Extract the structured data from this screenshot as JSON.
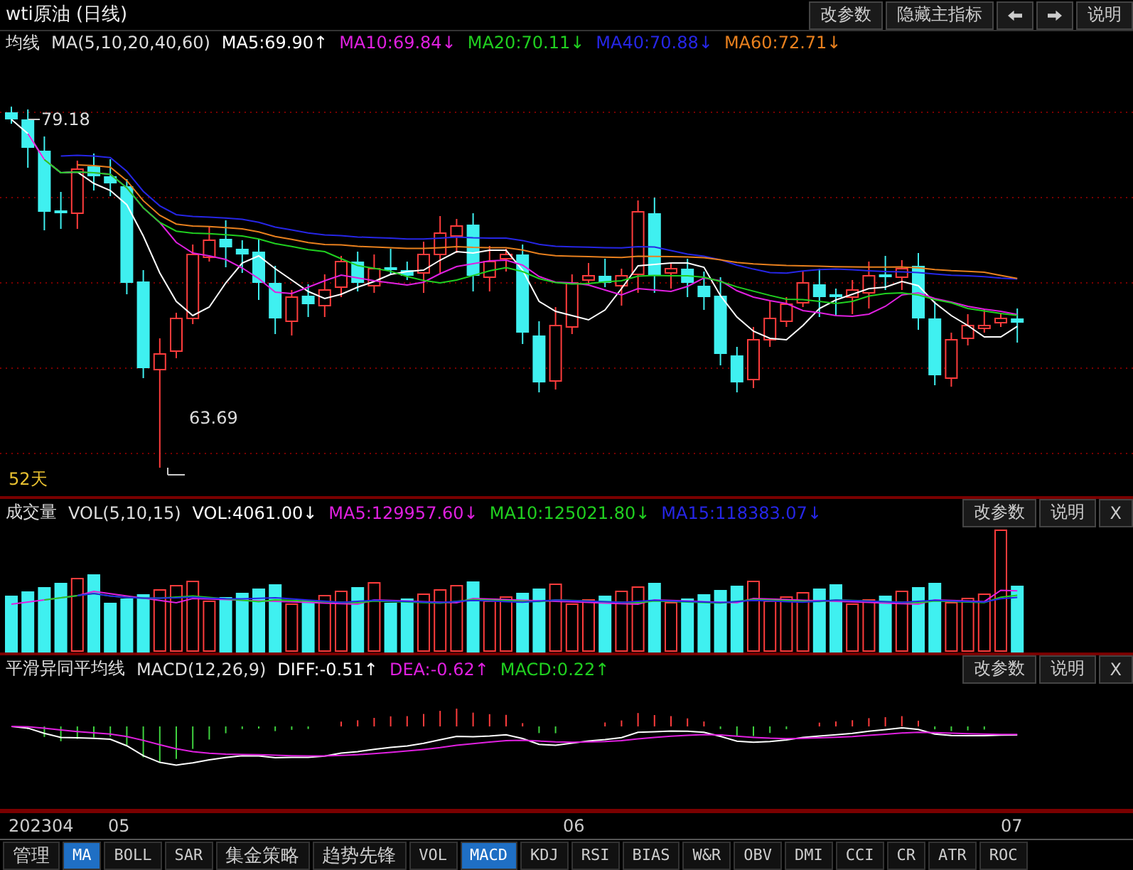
{
  "window": {
    "title": "wti原油 (日线)"
  },
  "toolbar": {
    "buttons": [
      {
        "kind": "text",
        "label": "改参数"
      },
      {
        "kind": "text",
        "label": "隐藏主指标"
      },
      {
        "kind": "prev"
      },
      {
        "kind": "next"
      },
      {
        "kind": "text",
        "label": "说明"
      }
    ]
  },
  "main_panel": {
    "title": "均线",
    "params": "MA(5,10,20,40,60)",
    "legend": [
      {
        "text": "MA5:69.90↑",
        "color": "#ffffff"
      },
      {
        "text": "MA10:69.84↓",
        "color": "#e020e0"
      },
      {
        "text": "MA20:70.11↓",
        "color": "#20d020"
      },
      {
        "text": "MA40:70.88↓",
        "color": "#2626e6"
      },
      {
        "text": "MA60:72.71↓",
        "color": "#e8801e"
      }
    ],
    "high_label": "79.18",
    "low_label": "63.69",
    "period": "52天"
  },
  "volume_panel": {
    "title": "成交量",
    "params": "VOL(5,10,15)",
    "legend": [
      {
        "text": "VOL:4061.00↓",
        "color": "#ffffff"
      },
      {
        "text": "MA5:129957.60↓",
        "color": "#e020e0"
      },
      {
        "text": "MA10:125021.80↓",
        "color": "#20d020"
      },
      {
        "text": "MA15:118383.07↓",
        "color": "#2626e6"
      }
    ],
    "buttons": [
      "改参数",
      "说明",
      "X"
    ]
  },
  "macd_panel": {
    "title": "平滑异同平均线",
    "params": "MACD(12,26,9)",
    "legend": [
      {
        "text": "DIFF:-0.51↑",
        "color": "#ffffff"
      },
      {
        "text": "DEA:-0.62↑",
        "color": "#e020e0"
      },
      {
        "text": "MACD:0.22↑",
        "color": "#20d020"
      }
    ],
    "buttons": [
      "改参数",
      "说明",
      "X"
    ]
  },
  "date_axis": [
    "202304",
    "05",
    "06",
    "07"
  ],
  "tabs": [
    {
      "label": "管理",
      "selected": false
    },
    {
      "label": "MA",
      "selected": true
    },
    {
      "label": "BOLL",
      "selected": false
    },
    {
      "label": "SAR",
      "selected": false
    },
    {
      "label": "集金策略",
      "selected": false
    },
    {
      "label": "趋势先锋",
      "selected": false
    },
    {
      "label": "VOL",
      "selected": false
    },
    {
      "label": "MACD",
      "selected": true
    },
    {
      "label": "KDJ",
      "selected": false
    },
    {
      "label": "RSI",
      "selected": false
    },
    {
      "label": "BIAS",
      "selected": false
    },
    {
      "label": "W&R",
      "selected": false
    },
    {
      "label": "OBV",
      "selected": false
    },
    {
      "label": "DMI",
      "selected": false
    },
    {
      "label": "CCI",
      "selected": false
    },
    {
      "label": "CR",
      "selected": false
    },
    {
      "label": "ATR",
      "selected": false
    },
    {
      "label": "ROC",
      "selected": false
    }
  ]
}
